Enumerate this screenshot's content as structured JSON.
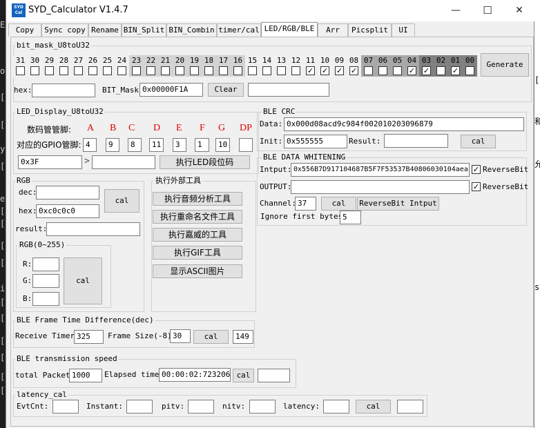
{
  "window": {
    "title": "SYD_Calculator V1.4.7",
    "icon_text": "SYD Cal",
    "minimize": "—",
    "maximize": "☐",
    "close": "✕"
  },
  "tabs": [
    "Copy",
    "Sync copy",
    "Rename",
    "BIN_Split",
    "BIN_Combin",
    "timer/cal",
    "LED/RGB/BLE",
    "Arr",
    "Picsplit",
    "UI"
  ],
  "active_tab": "LED/RGB/BLE",
  "bitmask": {
    "group_title": "bit_mask_U8toU32",
    "bits": [
      "31",
      "30",
      "29",
      "28",
      "27",
      "26",
      "25",
      "24",
      "23",
      "22",
      "21",
      "20",
      "19",
      "18",
      "17",
      "16",
      "15",
      "14",
      "13",
      "12",
      "11",
      "10",
      "09",
      "08",
      "07",
      "06",
      "05",
      "04",
      "03",
      "02",
      "01",
      "00"
    ],
    "checked": [
      false,
      false,
      false,
      false,
      false,
      false,
      false,
      false,
      false,
      false,
      false,
      false,
      false,
      false,
      false,
      false,
      false,
      false,
      false,
      false,
      true,
      true,
      true,
      true,
      false,
      false,
      false,
      true,
      true,
      false,
      true,
      false
    ],
    "shade_colors": [
      "#f0f0f0",
      "#d3d3d3",
      "#a9a9a9",
      "#808080"
    ],
    "generate_label": "Generate",
    "hex_label": "hex:",
    "hex_value": "",
    "bitmask_label": "BIT_Mask:",
    "bitmask_value": "0x00000F1A",
    "clear_label": "Clear",
    "extra_value": ""
  },
  "led": {
    "group_title": "LED_Display_U8toU32",
    "pin_label": "数码管管脚:",
    "pins": [
      "A",
      "B",
      "C",
      "D",
      "E",
      "F",
      "G",
      "DP"
    ],
    "gpio_label": "对应的GPIO管脚:",
    "gpios": [
      "4",
      "9",
      "8",
      "11",
      "3",
      "1",
      "10",
      ""
    ],
    "input_value": "0x3F",
    "arrow": ">",
    "output_value": "",
    "exec_label": "执行LED段位码"
  },
  "rgb": {
    "group_title": "RGB",
    "dec_label": "dec:",
    "dec_value": "",
    "hex_label": "hex:",
    "hex_value": "0xc0c0c0",
    "cal_label": "cal",
    "result_label": "result:",
    "result_value": "",
    "sub_title": "RGB(0~255)",
    "r_label": "R:",
    "g_label": "G:",
    "b_label": "B:",
    "r_value": "",
    "g_value": "",
    "b_value": "",
    "cal2_label": "cal"
  },
  "tools": {
    "group_title": "执行外部工具",
    "buttons": [
      "执行音频分析工具",
      "执行重命名文件工具",
      "执行嘉威的工具",
      "执行GIF工具",
      "显示ASCII图片"
    ]
  },
  "ble_crc": {
    "group_title": "BLE CRC",
    "data_label": "Data:",
    "data_value": "0x000d08acd9c984f002010203096879",
    "init_label": "Init:",
    "init_value": "0x555555",
    "result_label": "Result:",
    "result_value": "",
    "cal_label": "cal"
  },
  "ble_whitening": {
    "group_title": "BLE DATA WHITENING",
    "input_label": "Intput:",
    "input_value": "0x556B7D917104687B5F7F53537B40806030104aea",
    "reverse1_label": "ReverseBit",
    "reverse1_checked": true,
    "output_label": "OUTPUT:",
    "output_value": "",
    "reverse2_label": "ReverseBit",
    "reverse2_checked": true,
    "channel_label": "Channel:",
    "channel_value": "37",
    "cal_label": "cal",
    "reverse_input_label": "ReverseBit Intput",
    "ignore_label": "Ignore first bytes:",
    "ignore_value": "5"
  },
  "frame_time": {
    "group_title": "BLE Frame Time Difference(dec)",
    "receive_label": "Receive Timer:",
    "receive_value": "325",
    "frame_label": "Frame Size(-8):",
    "frame_value": "30",
    "cal_label": "cal",
    "result_value": "149"
  },
  "speed": {
    "group_title": "BLE transmission speed",
    "packet_label": "total Packet:",
    "packet_value": "1000",
    "elapsed_label": "Elapsed time:",
    "elapsed_value": "00:00:02:723206",
    "cal_label": "cal",
    "result_value": ""
  },
  "latency": {
    "group_title": "latency_cal",
    "evtcnt_label": "EvtCnt:",
    "instant_label": "Instant:",
    "pitv_label": "pitv:",
    "nitv_label": "nitv:",
    "latency_label": "latency:",
    "cal_label": "cal",
    "evtcnt_value": "",
    "instant_value": "",
    "pitv_value": "",
    "nitv_value": "",
    "latency_value": "",
    "result_value": ""
  },
  "background_left": [
    "EA",
    "o",
    "[",
    "[",
    "y",
    "[",
    "e",
    "[",
    "[",
    "[",
    "[",
    "i",
    "[",
    "[",
    "[",
    "[",
    "[",
    "["
  ],
  "background_right": [
    "[",
    "和",
    "允",
    "s."
  ]
}
